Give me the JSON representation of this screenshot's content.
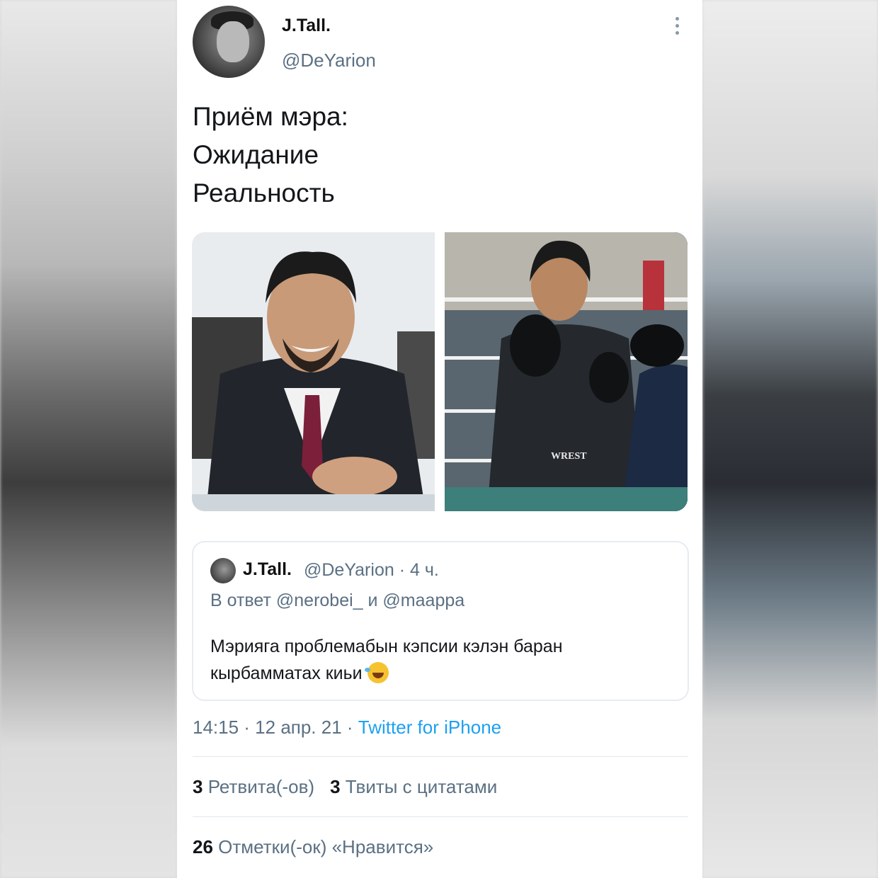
{
  "author": {
    "name": "J.Tall.",
    "handle": "@DeYarion"
  },
  "tweet": {
    "lines": [
      "Приём мэра:",
      "Ожидание",
      "Реальность"
    ]
  },
  "quoted": {
    "name": "J.Tall.",
    "meta": "@DeYarion · 4 ч.",
    "reply": "В ответ @nerobei_ и @maappa",
    "text": "Мэрияга проблемабын кэпсии кэлэн баран кырбамматах киьи"
  },
  "timestamp": {
    "time": "14:15 · 12 апр. 21 · ",
    "source": "Twitter for iPhone"
  },
  "stats": {
    "retweets_count": "3",
    "retweets_label": "Ретвита(-ов)",
    "quotes_count": "3",
    "quotes_label": "Твиты с цитатами",
    "likes_count": "26",
    "likes_label": "Отметки(-ок) «Нравится»"
  },
  "colors": {
    "secondary_text": "#5b7083",
    "link": "#1da1f2",
    "divider": "#e1e8ed"
  }
}
